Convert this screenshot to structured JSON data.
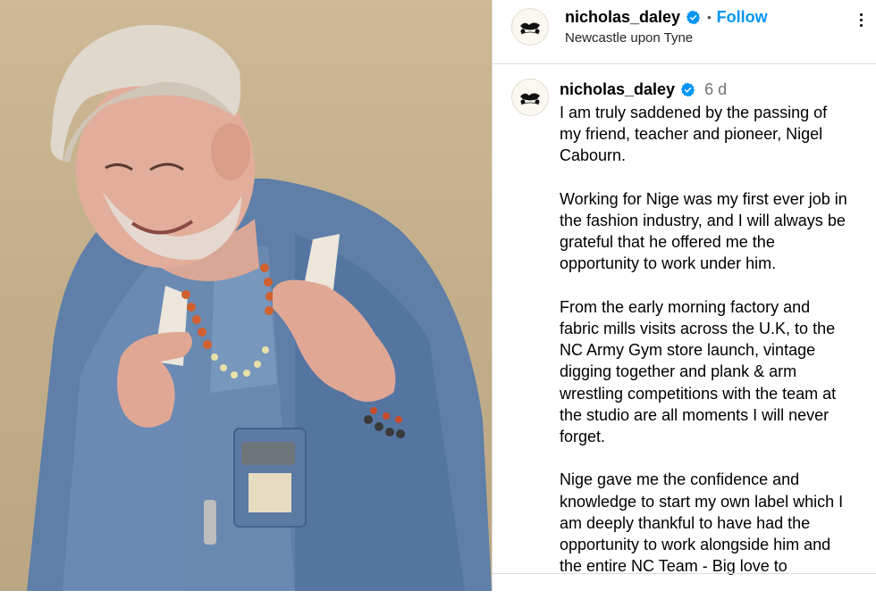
{
  "header": {
    "username": "nicholas_daley",
    "follow_label": "Follow",
    "separator": "•",
    "location": "Newcastle upon Tyne",
    "avatar_icon": "nicholas-daley-logo-icon",
    "more_icon": "more-options-icon"
  },
  "post": {
    "username": "nicholas_daley",
    "time": "6 d",
    "caption_lines": [
      [
        "I am truly saddened by the passing of",
        "my friend, teacher and pioneer, Nigel",
        "Cabourn."
      ],
      [
        "Working for Nige was my first ever job in",
        "the fashion industry, and I will always be",
        "grateful that he offered me the",
        "opportunity to work under him."
      ],
      [
        "From the early morning factory and",
        "fabric mills visits across the U.K, to the",
        "NC Army Gym store launch, vintage",
        "digging together and plank & arm",
        "wrestling competitions with the team at",
        "the studio are all moments I will never",
        "forget."
      ],
      [
        "Nige gave me the confidence and",
        "knowledge to start my own label which I",
        "am deeply thankful to have had the",
        "opportunity to work alongside him and",
        "the entire NC Team - Big love to"
      ]
    ]
  },
  "colors": {
    "accent": "#0095f6",
    "verified": "#0095f6",
    "muted": "#737373",
    "border": "#dbdbdb",
    "photo_background": "#c8b48f"
  }
}
